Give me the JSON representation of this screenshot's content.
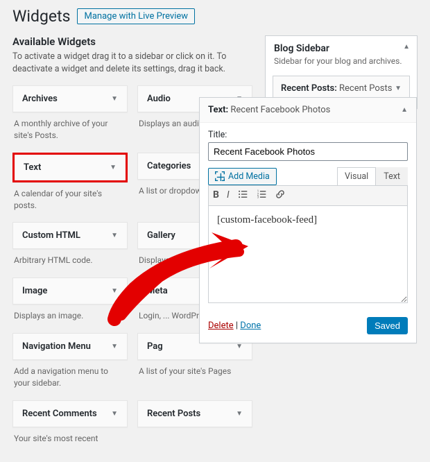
{
  "page": {
    "title": "Widgets",
    "title_action": "Manage with Live Preview"
  },
  "available": {
    "heading": "Available Widgets",
    "description": "To activate a widget drag it to a sidebar or click on it. To deactivate a widget and delete its settings, drag it back.",
    "items": [
      {
        "name": "Archives",
        "desc": "A monthly archive of your site's Posts."
      },
      {
        "name": "Audio",
        "desc": "Displays an audio player."
      },
      {
        "name": "Text",
        "desc": "A calendar of your site's posts.",
        "highlight": true
      },
      {
        "name": "Categories",
        "desc": "A list or dropdown of cate"
      },
      {
        "name": "Custom HTML",
        "desc": "Arbitrary HTML code."
      },
      {
        "name": "Gallery",
        "desc": "Displays an image gallery"
      },
      {
        "name": "Image",
        "desc": "Displays an image."
      },
      {
        "name": "Meta",
        "desc": "Login, ... WordPre... links."
      },
      {
        "name": "Navigation Menu",
        "desc": "Add a navigation menu to your sidebar."
      },
      {
        "name": "Pag",
        "desc": "A list of your site's Pages"
      },
      {
        "name": "Recent Comments",
        "desc": "Your site's most recent"
      },
      {
        "name": "Recent Posts",
        "desc": ""
      }
    ]
  },
  "sidebar": {
    "title": "Blog Sidebar",
    "caption": "Sidebar for your blog and archives.",
    "item_type": "Recent Posts:",
    "item_title": "Recent Posts"
  },
  "editor": {
    "head_type": "Text:",
    "head_title": "Recent Facebook Photos",
    "title_label": "Title:",
    "title_value": "Recent Facebook Photos",
    "add_media": "Add Media",
    "tab_visual": "Visual",
    "tab_text": "Text",
    "content": "[custom-facebook-feed]",
    "delete": "Delete",
    "done": "Done",
    "saved": "Saved"
  }
}
